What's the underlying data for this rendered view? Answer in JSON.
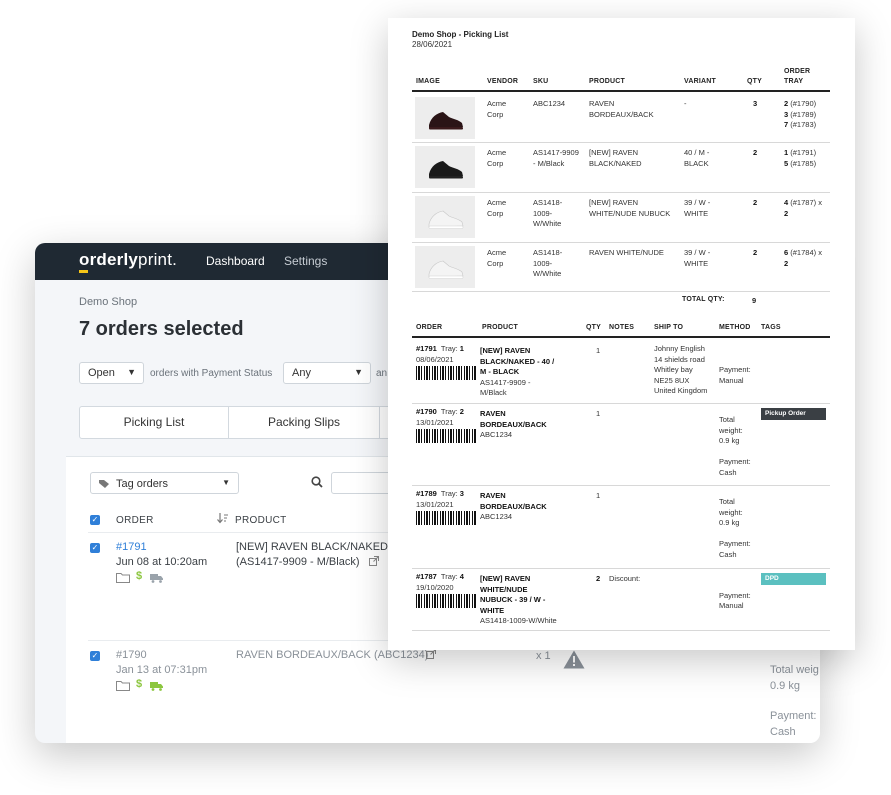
{
  "app": {
    "logo_bold": "orderly",
    "logo_light": "print.",
    "nav": {
      "dashboard": "Dashboard",
      "settings": "Settings"
    },
    "shop_name": "Demo Shop",
    "page_title": "7 orders selected",
    "filters": {
      "status_value": "Open",
      "with_payment_label": "orders with Payment Status",
      "payment_value": "Any",
      "trailing": "an"
    },
    "tabs": [
      "Picking List",
      "Packing Slips"
    ],
    "tag_orders_label": "Tag orders",
    "table": {
      "headers": {
        "order": "ORDER",
        "product": "PRODUCT"
      },
      "rows": [
        {
          "order": "#1791",
          "date": "Jun 08 at 10:20am",
          "product": "[NEW] RAVEN BLACK/NAKED -",
          "product_line2": "(AS1417-9909 - M/Black)",
          "qty": "",
          "weight": "",
          "payment": "",
          "payment2": ""
        },
        {
          "order": "#1790",
          "date": "Jan 13 at 07:31pm",
          "product": "RAVEN BORDEAUX/BACK (ABC1234)",
          "product_line2": "",
          "qty": "x 1",
          "weight": "Total weig",
          "weight2": "0.9 kg",
          "payment": "Payment:",
          "payment2": "Cash"
        }
      ]
    },
    "colors": {
      "nav": "#1f2933",
      "accent": "#2f7fd8",
      "logo_accent": "#f5c518",
      "dollar": "#8cc63f",
      "truck": "#8cc63f"
    }
  },
  "sheet": {
    "title": "Demo Shop - Picking List",
    "date": "28/06/2021",
    "pick_headers": [
      "IMAGE",
      "VENDOR",
      "SKU",
      "PRODUCT",
      "VARIANT",
      "QTY",
      "ORDER",
      "TRAY"
    ],
    "pick_rows": [
      {
        "vendor": [
          "Acme",
          "Corp"
        ],
        "sku": [
          "ABC1234"
        ],
        "product": [
          "RAVEN",
          "BORDEAUX/BACK"
        ],
        "variant": [
          "-"
        ],
        "qty": "3",
        "tray": [
          [
            "2",
            " (#1790)"
          ],
          [
            "3",
            " (#1789)"
          ],
          [
            "7",
            " (#1783)"
          ]
        ],
        "shoe": "dark-red"
      },
      {
        "vendor": [
          "Acme",
          "Corp"
        ],
        "sku": [
          "AS1417-9909",
          "- M/Black"
        ],
        "product": [
          "[NEW] RAVEN",
          "BLACK/NAKED"
        ],
        "variant": [
          "40 / M -",
          "BLACK"
        ],
        "qty": "2",
        "tray": [
          [
            "1",
            " (#1791)"
          ],
          [
            "5",
            " (#1785)"
          ]
        ],
        "shoe": "black"
      },
      {
        "vendor": [
          "Acme",
          "Corp"
        ],
        "sku": [
          "AS1418-",
          "1009-",
          "W/White"
        ],
        "product": [
          "[NEW] RAVEN",
          "WHITE/NUDE NUBUCK"
        ],
        "variant": [
          "39 / W -",
          "WHITE"
        ],
        "qty": "2",
        "tray": [
          [
            "4",
            " (#1787) x"
          ],
          [
            "2",
            ""
          ]
        ],
        "shoe": "white"
      },
      {
        "vendor": [
          "Acme",
          "Corp"
        ],
        "sku": [
          "AS1418-",
          "1009-",
          "W/White"
        ],
        "product": [
          "RAVEN WHITE/NUDE"
        ],
        "variant": [
          "39 / W -",
          "WHITE"
        ],
        "qty": "2",
        "tray": [
          [
            "6",
            " (#1784) x"
          ],
          [
            "2",
            ""
          ]
        ],
        "shoe": "white"
      }
    ],
    "total_qty_label": "TOTAL QTY:",
    "total_qty": "9",
    "order_headers": [
      "ORDER",
      "PRODUCT",
      "QTY",
      "NOTES",
      "SHIP TO",
      "METHOD",
      "TAGS"
    ],
    "orders": [
      {
        "order": "#1791",
        "tray_label": "Tray:",
        "tray": "1",
        "date": "08/06/2021",
        "product": [
          "[NEW] RAVEN",
          "BLACK/NAKED - 40 /",
          "M - BLACK"
        ],
        "sku": [
          "AS1417-9909 -",
          "M/Black"
        ],
        "qty": "1",
        "notes": "",
        "ship_to": [
          "Johnny English",
          "14 shields road",
          "Whitley bay",
          "NE25 8UX",
          "United Kingdom"
        ],
        "method": [
          "",
          "",
          "Payment:",
          "Manual"
        ],
        "tag": ""
      },
      {
        "order": "#1790",
        "tray_label": "Tray:",
        "tray": "2",
        "date": "13/01/2021",
        "product": [
          "RAVEN",
          "BORDEAUX/BACK"
        ],
        "sku": [
          "ABC1234"
        ],
        "qty": "1",
        "notes": "",
        "ship_to": [],
        "method": [
          "Total",
          "weight:",
          "0.9 kg",
          "",
          "Payment:",
          "Cash"
        ],
        "tag": "Pickup Order"
      },
      {
        "order": "#1789",
        "tray_label": "Tray:",
        "tray": "3",
        "date": "13/01/2021",
        "product": [
          "RAVEN",
          "BORDEAUX/BACK"
        ],
        "sku": [
          "ABC1234"
        ],
        "qty": "1",
        "notes": "",
        "ship_to": [],
        "method": [
          "Total",
          "weight:",
          "0.9 kg",
          "",
          "Payment:",
          "Cash"
        ],
        "tag": ""
      },
      {
        "order": "#1787",
        "tray_label": "Tray:",
        "tray": "4",
        "date": "19/10/2020",
        "product": [
          "[NEW] RAVEN",
          "WHITE/NUDE",
          "NUBUCK - 39 / W -",
          "WHITE"
        ],
        "sku": [
          "AS1418-1009-W/White"
        ],
        "qty": "2",
        "notes": "Discount:",
        "ship_to": [],
        "method": [
          "",
          "Payment:",
          "Manual"
        ],
        "tag": "DPD"
      }
    ]
  }
}
